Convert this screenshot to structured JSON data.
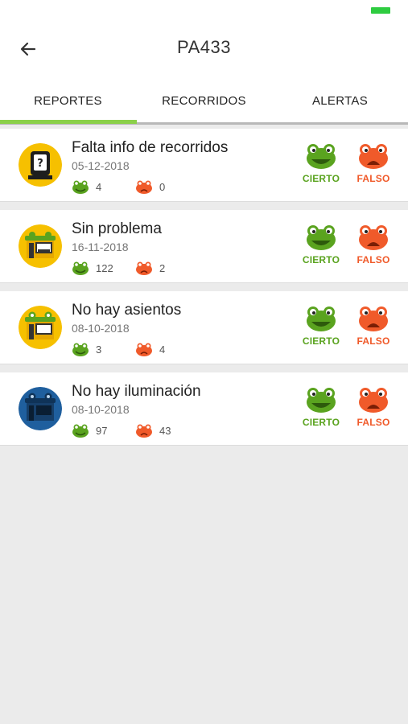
{
  "header": {
    "title": "PA433"
  },
  "tabs": [
    {
      "label": "REPORTES",
      "active": true
    },
    {
      "label": "RECORRIDOS",
      "active": false
    },
    {
      "label": "ALERTAS",
      "active": false
    }
  ],
  "colors": {
    "accent": "#8bd04a",
    "true": "#5aa31f",
    "false": "#f05a2a"
  },
  "vote_labels": {
    "true": "CIERTO",
    "false": "FALSO"
  },
  "reports": [
    {
      "title": "Falta info de recorridos",
      "date": "05-12-2018",
      "true_count": "4",
      "false_count": "0",
      "icon": "info-sign-icon"
    },
    {
      "title": "Sin problema",
      "date": "16-11-2018",
      "true_count": "122",
      "false_count": "2",
      "icon": "bus-stop-happy-icon"
    },
    {
      "title": "No hay asientos",
      "date": "08-10-2018",
      "true_count": "3",
      "false_count": "4",
      "icon": "bus-stop-seats-icon"
    },
    {
      "title": "No hay iluminación",
      "date": "08-10-2018",
      "true_count": "97",
      "false_count": "43",
      "icon": "bus-stop-dark-icon"
    }
  ]
}
